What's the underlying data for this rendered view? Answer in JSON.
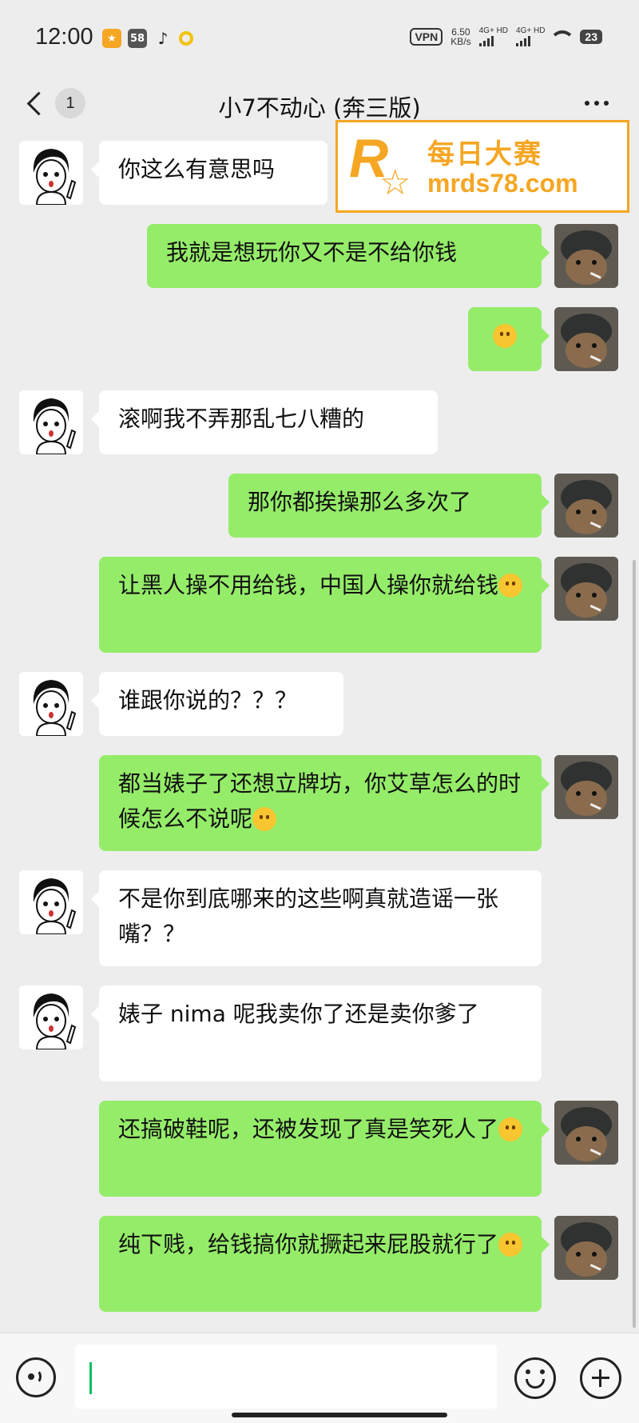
{
  "status_bar": {
    "time": "12:00",
    "app_icons": [
      "app-icon",
      "58-icon",
      "tiktok-icon",
      "ring-icon"
    ],
    "badge_58": "58",
    "vpn": "VPN",
    "speed_value": "6.50",
    "speed_unit": "KB/s",
    "net1": "4G+ HD",
    "net2": "4G+ HD",
    "battery": "23"
  },
  "header": {
    "back_count": "1",
    "title": "小7不动心 (奔三版)"
  },
  "watermark": {
    "logo_letter": "R",
    "logo_small": "每日大赛",
    "cn": "每日大赛",
    "url": "mrds78.com"
  },
  "messages": [
    {
      "side": "left",
      "text": "你这么有意思吗",
      "emoji": null
    },
    {
      "side": "right",
      "text": "我就是想玩你又不是不给你钱",
      "emoji": null
    },
    {
      "side": "right",
      "text": "",
      "emoji": "money-mouth-emoji"
    },
    {
      "side": "left",
      "text": "滚啊我不弄那乱七八糟的",
      "emoji": null
    },
    {
      "side": "right",
      "text": "那你都挨操那么多次了",
      "emoji": null
    },
    {
      "side": "right",
      "text": "让黑人操不用给钱，中国人操你就给钱",
      "emoji": "thinking-emoji"
    },
    {
      "side": "left",
      "text": "谁跟你说的？？？",
      "emoji": null
    },
    {
      "side": "right",
      "text": "都当婊子了还想立牌坊，你艾草怎么的时候怎么不说呢",
      "emoji": "thinking-emoji"
    },
    {
      "side": "left",
      "text": "不是你到底哪来的这些啊真就造谣一张嘴？？",
      "emoji": null
    },
    {
      "side": "left",
      "text": "婊子 nima 呢我卖你了还是卖你爹了",
      "emoji": null
    },
    {
      "side": "right",
      "text": "还搞破鞋呢，还被发现了真是笑死人了",
      "emoji": "laughing-emoji"
    },
    {
      "side": "right",
      "text": "纯下贱，给钱搞你就撅起来屁股就行了",
      "emoji": "thinking-emoji"
    }
  ],
  "input_bar": {
    "value": "",
    "icons": [
      "voice-icon",
      "emoji-icon",
      "plus-icon"
    ]
  }
}
